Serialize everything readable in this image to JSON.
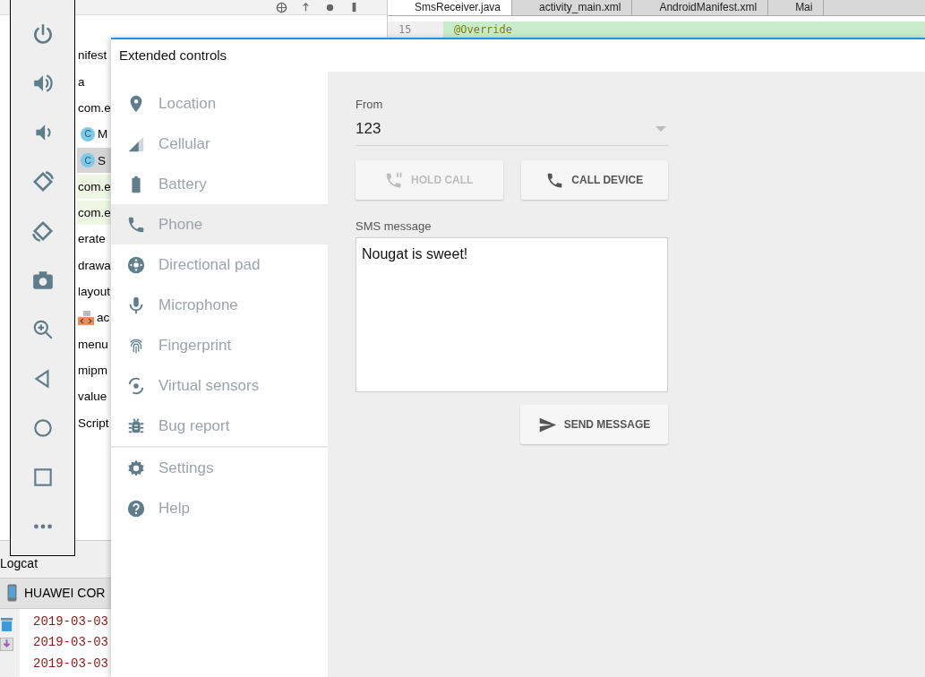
{
  "ide": {
    "editor_tabs": [
      {
        "label": "SmsReceiver.java",
        "selected": true
      },
      {
        "label": "activity_main.xml",
        "selected": false
      },
      {
        "label": "AndroidManifest.xml",
        "selected": false
      },
      {
        "label": "Mai",
        "selected": false
      }
    ],
    "code_lines": [
      {
        "number": "15",
        "text": "@Override"
      }
    ],
    "project_tree": [
      {
        "label": "nifest",
        "selected": false,
        "highlighted": false
      },
      {
        "label": "a",
        "selected": false,
        "highlighted": false,
        "children": [
          {
            "label": "com.e",
            "selected": false,
            "highlighted": false,
            "children": [
              {
                "label": "M",
                "badge": "C",
                "selected": false,
                "highlighted": false
              },
              {
                "label": "S",
                "badge": "C",
                "selected": true,
                "highlighted": false
              }
            ]
          },
          {
            "label": "com.e",
            "selected": false,
            "highlighted": true
          },
          {
            "label": "com.e",
            "selected": false,
            "highlighted": true
          }
        ]
      },
      {
        "label": "erate",
        "selected": false,
        "highlighted": false
      },
      {
        "label": "drawa",
        "selected": false,
        "highlighted": false
      },
      {
        "label": "layout",
        "selected": false,
        "highlighted": false,
        "children": [
          {
            "label": "ac",
            "kind": "xml",
            "selected": false,
            "highlighted": false
          }
        ]
      },
      {
        "label": "menu",
        "selected": false,
        "highlighted": false
      },
      {
        "label": "mipm",
        "selected": false,
        "highlighted": false
      },
      {
        "label": "value",
        "selected": false,
        "highlighted": false
      },
      {
        "label": "Script",
        "selected": false,
        "highlighted": false
      }
    ],
    "logcat": {
      "title": "Logcat",
      "device": "HUAWEI COR",
      "lines": [
        "2019-03-03",
        "2019-03-03",
        "2019-03-03"
      ]
    }
  },
  "extended_controls": {
    "title": "Extended controls",
    "nav": [
      {
        "label": "Location",
        "selected": false
      },
      {
        "label": "Cellular",
        "selected": false
      },
      {
        "label": "Battery",
        "selected": false
      },
      {
        "label": "Phone",
        "selected": true
      },
      {
        "label": "Directional pad",
        "selected": false
      },
      {
        "label": "Microphone",
        "selected": false
      },
      {
        "label": "Fingerprint",
        "selected": false
      },
      {
        "label": "Virtual sensors",
        "selected": false
      },
      {
        "label": "Bug report",
        "selected": false
      }
    ],
    "nav_footer": [
      {
        "label": "Settings",
        "selected": false
      },
      {
        "label": "Help",
        "selected": false
      }
    ],
    "phone": {
      "from_label": "From",
      "from_value": "123",
      "hold_button": {
        "label": "HOLD CALL",
        "disabled": true
      },
      "call_button": {
        "label": "CALL DEVICE",
        "disabled": false
      },
      "sms_label": "SMS message",
      "sms_value": "Nougat is sweet!",
      "send_button": {
        "label": "SEND MESSAGE",
        "disabled": false
      }
    }
  }
}
